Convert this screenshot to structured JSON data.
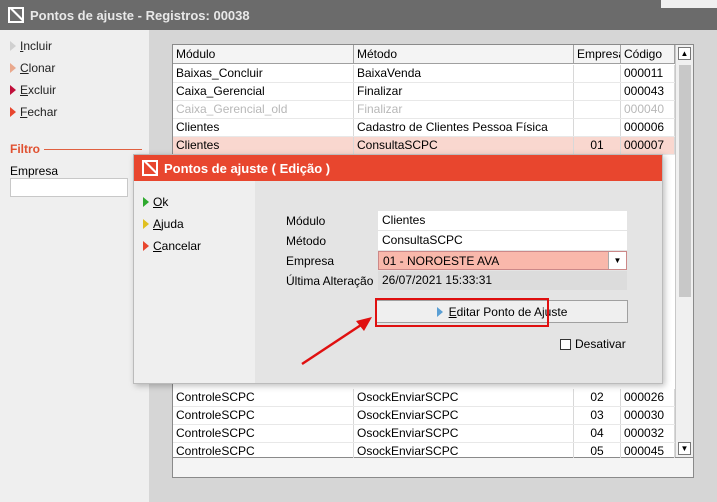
{
  "window": {
    "title": "Pontos de ajuste - Registros: 00038"
  },
  "sidebar": {
    "items": [
      {
        "label": "Incluir",
        "u": "I",
        "rest": "ncluir",
        "color": "#d0d0d0"
      },
      {
        "label": "Clonar",
        "u": "C",
        "rest": "lonar",
        "color": "#e9a88c"
      },
      {
        "label": "Excluir",
        "u": "E",
        "rest": "xcluir",
        "color": "#c0103a"
      },
      {
        "label": "Fechar",
        "u": "F",
        "rest": "echar",
        "color": "#e8462e"
      }
    ],
    "filter_title": "Filtro",
    "empresa_label": "Empresa",
    "empresa_value": ""
  },
  "grid": {
    "headers": [
      "Módulo",
      "Método",
      "Empresa",
      "Código"
    ],
    "rows": [
      {
        "modulo": "Baixas_Concluir",
        "metodo": "BaixaVenda",
        "empresa": "",
        "codigo": "000011",
        "state": "normal"
      },
      {
        "modulo": "Caixa_Gerencial",
        "metodo": "Finalizar",
        "empresa": "",
        "codigo": "000043",
        "state": "normal"
      },
      {
        "modulo": "Caixa_Gerencial_old",
        "metodo": "Finalizar",
        "empresa": "",
        "codigo": "000040",
        "state": "dim"
      },
      {
        "modulo": "Clientes",
        "metodo": "Cadastro de Clientes Pessoa Física",
        "empresa": "",
        "codigo": "000006",
        "state": "normal"
      },
      {
        "modulo": "Clientes",
        "metodo": "ConsultaSCPC",
        "empresa": "01",
        "codigo": "000007",
        "state": "selected"
      },
      {
        "modulo": "ControleSCPC",
        "metodo": "OsockEnviarSCPC",
        "empresa": "02",
        "codigo": "000026",
        "state": "normal"
      },
      {
        "modulo": "ControleSCPC",
        "metodo": "OsockEnviarSCPC",
        "empresa": "03",
        "codigo": "000030",
        "state": "normal"
      },
      {
        "modulo": "ControleSCPC",
        "metodo": "OsockEnviarSCPC",
        "empresa": "04",
        "codigo": "000032",
        "state": "normal"
      },
      {
        "modulo": "ControleSCPC",
        "metodo": "OsockEnviarSCPC",
        "empresa": "05",
        "codigo": "000045",
        "state": "normal"
      }
    ]
  },
  "dialog": {
    "title": "Pontos de ajuste ( Edição )",
    "menu": [
      {
        "label": "Ok",
        "u": "O",
        "rest": "k",
        "color": "#2eaa2e"
      },
      {
        "label": "Ajuda",
        "u": "A",
        "rest": "juda",
        "color": "#e0c020"
      },
      {
        "label": "Cancelar",
        "u": "C",
        "rest": "ancelar",
        "color": "#e8462e"
      }
    ],
    "fields": {
      "modulo_label": "Módulo",
      "modulo_value": "Clientes",
      "metodo_label": "Método",
      "metodo_value": "ConsultaSCPC",
      "empresa_label": "Empresa",
      "empresa_value": "01 - NOROESTE AVA",
      "alteracao_label": "Última Alteração",
      "alteracao_value": "26/07/2021 15:33:31"
    },
    "edit_button": {
      "label": "Editar Ponto de Ajuste",
      "u": "E",
      "rest": "ditar Ponto de Ajuste"
    },
    "desativar_label": "Desativar",
    "desativar_checked": false
  },
  "colors": {
    "accent": "#e8462e",
    "selected_row": "#f9d7cf",
    "annotation": "#e01010"
  }
}
